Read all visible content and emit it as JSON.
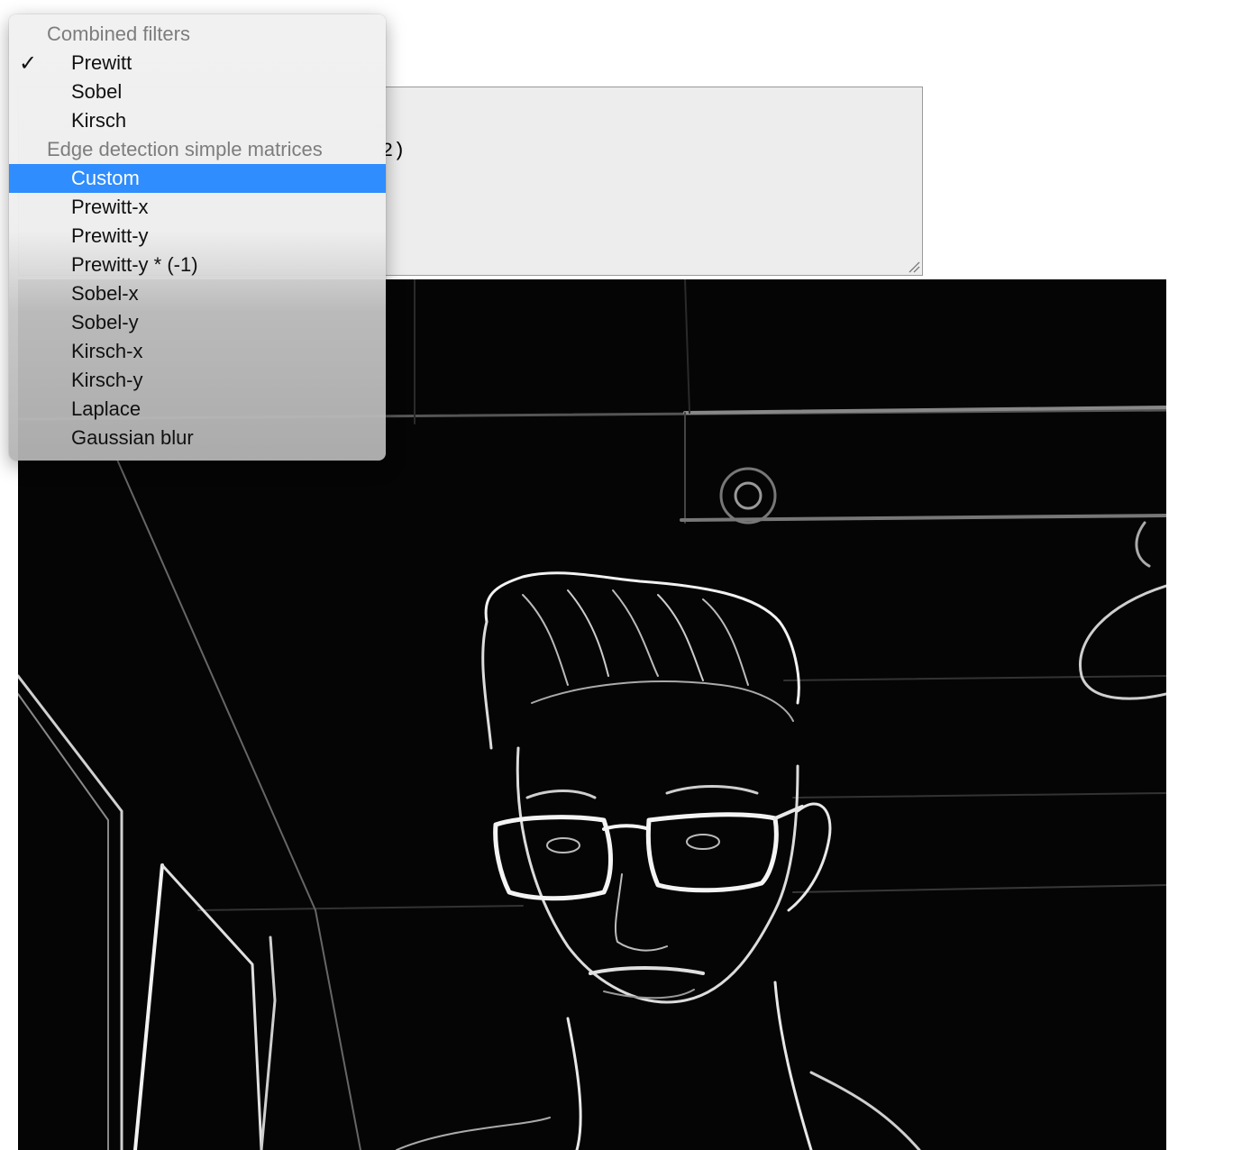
{
  "filter_menu": {
    "groups": [
      {
        "label": "Combined filters",
        "options": [
          "Prewitt",
          "Sobel",
          "Kirsch"
        ]
      },
      {
        "label": "Edge detection simple matrices",
        "options": [
          "Custom",
          "Prewitt-x",
          "Prewitt-y",
          "Prewitt-y * (-1)",
          "Sobel-x",
          "Sobel-y",
          "Kirsch-x",
          "Kirsch-y",
          "Laplace",
          "Gaussian blur"
        ]
      }
    ],
    "checked_option": "Prewitt",
    "highlighted_option": "Custom",
    "checkmark": "✓",
    "highlight_color": "#2f8dfd"
  },
  "matrix_textarea": {
    "visible_text_fragment": "2)"
  },
  "output_canvas": {
    "description_icon": "edge-detected-portrait-image"
  }
}
